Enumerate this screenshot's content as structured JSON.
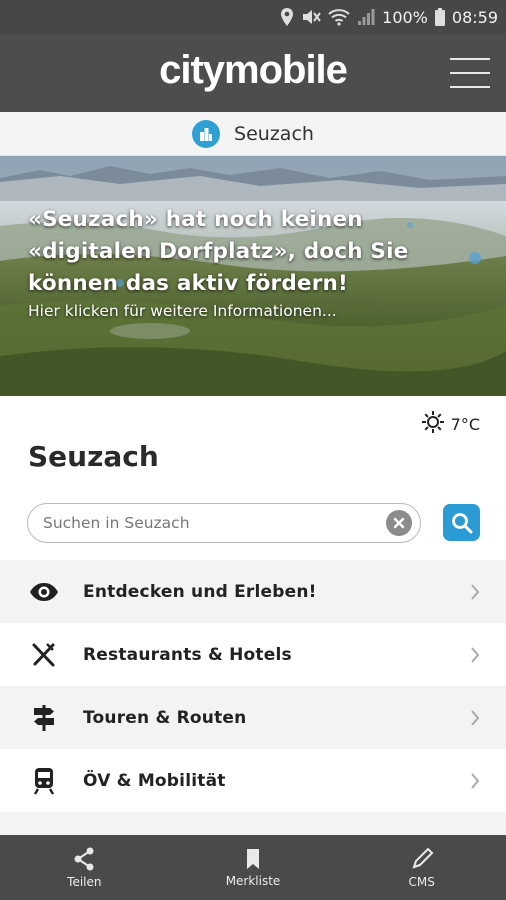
{
  "status_bar": {
    "battery": "100%",
    "time": "08:59"
  },
  "header": {
    "brand": "citymobile"
  },
  "location": {
    "name": "Seuzach"
  },
  "hero": {
    "title_line1": "«Seuzach» hat noch keinen",
    "title_line2": "«digitalen Dorfplatz», doch Sie",
    "title_line3": "können das aktiv fördern!",
    "subtitle": "Hier klicken für weitere Informationen..."
  },
  "weather": {
    "temperature": "7°C",
    "icon": "sun-icon"
  },
  "page_title": "Seuzach",
  "search": {
    "placeholder": "Suchen in Seuzach",
    "value": ""
  },
  "menu_items": [
    {
      "label": "Entdecken und Erleben!",
      "icon": "eye-icon"
    },
    {
      "label": "Restaurants & Hotels",
      "icon": "cutlery-icon"
    },
    {
      "label": "Touren & Routen",
      "icon": "signpost-icon"
    },
    {
      "label": "ÖV & Mobilität",
      "icon": "train-icon"
    }
  ],
  "bottom_nav": [
    {
      "label": "Teilen",
      "icon": "share-icon"
    },
    {
      "label": "Merkliste",
      "icon": "bookmark-icon"
    },
    {
      "label": "CMS",
      "icon": "pencil-icon"
    }
  ],
  "colors": {
    "accent": "#2a9bd4",
    "header": "#4d4d4d",
    "bottom_nav": "#4a4a4a"
  }
}
